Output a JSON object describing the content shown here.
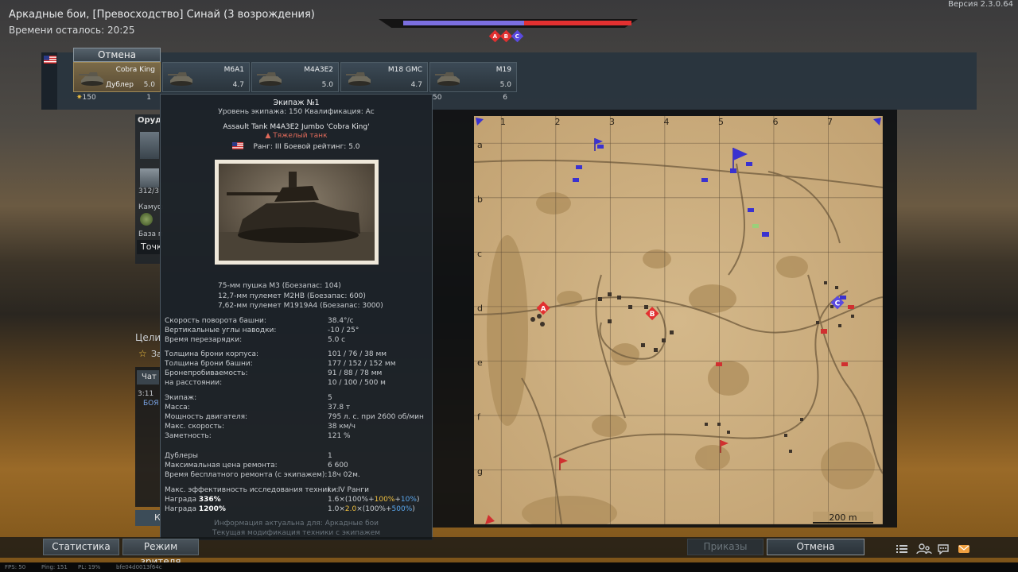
{
  "header": {
    "battle_title": "Аркадные бои, [Превосходство] Синай (3 возрождения)",
    "time_left": "Времени осталось: 20:25",
    "version": "Версия 2.3.0.64"
  },
  "score": {
    "blue_fraction": 0.53,
    "colors": {
      "blue": "#7b6fe0",
      "red": "#e23030"
    }
  },
  "zones": [
    {
      "label": "A",
      "color": "#e23030"
    },
    {
      "label": "B",
      "color": "#e23030"
    },
    {
      "label": "C",
      "color": "#5a4ae0"
    }
  ],
  "vehicles": {
    "cancel_label": "Отмена",
    "slots": [
      {
        "name": "Cobra King",
        "br": "5.0",
        "role": "Дублер",
        "selected": true
      },
      {
        "name": "M6A1",
        "br": "4.7",
        "role": "",
        "selected": false
      },
      {
        "name": "M4A3E2",
        "br": "5.0",
        "role": "",
        "selected": false
      },
      {
        "name": "M18 GMC",
        "br": "4.7",
        "role": "",
        "selected": false
      },
      {
        "name": "M19",
        "br": "5.0",
        "role": "",
        "selected": false
      }
    ],
    "slot_under": [
      {
        "left": "150",
        "right": "1"
      },
      {
        "left": "50",
        "right": "6"
      }
    ]
  },
  "left_fragments": {
    "weapons": "Оруд",
    "ammo": "312/3",
    "camo": "Камуф",
    "base": "База п",
    "point": "Точк",
    "goals": "Цели",
    "goal_item": "За",
    "chat_tab": "Чат",
    "chat_time": "3:11",
    "chat_word": "БОЯ",
    "k_button": "К"
  },
  "tooltip": {
    "crew_title": "Экипаж №1",
    "crew_level": "Уровень экипажа: 150   Квалификация: Ас",
    "vehicle_name": "Assault Tank M4A3E2 Jumbo 'Cobra King'",
    "vehicle_class": "Тяжелый танк",
    "rank_line": "Ранг: III   Боевой рейтинг: 5.0",
    "armament": [
      "75-мм пушка M3 (Боезапас: 104)",
      "12,7-мм пулемет M2HB (Боезапас: 600)",
      "7,62-мм пулемет M1919A4 (Боезапас: 3000)"
    ],
    "stats_group1": [
      {
        "label": "Скорость поворота башни:",
        "value": "38.4°/с"
      },
      {
        "label": "Вертикальные углы наводки:",
        "value": "-10 / 25°"
      },
      {
        "label": "Время перезарядки:",
        "value": "5.0 с"
      }
    ],
    "stats_group2": [
      {
        "label": "Толщина брони корпуса:",
        "value": "101 / 76 / 38 мм"
      },
      {
        "label": "Толщина брони башни:",
        "value": "177 / 152 / 152 мм"
      },
      {
        "label": "Бронепробиваемость:",
        "value": "91 / 88 / 78 мм"
      },
      {
        "label": "на расстоянии:",
        "value": "10 / 100 / 500 м"
      }
    ],
    "stats_group3": [
      {
        "label": "Экипаж:",
        "value": "5"
      },
      {
        "label": "Масса:",
        "value": "37.8 т"
      },
      {
        "label": "Мощность двигателя:",
        "value": "795 л. с. при 2600 об/мин"
      },
      {
        "label": "Макс. скорость:",
        "value": "38 км/ч"
      },
      {
        "label": "Заметность:",
        "value": "121 %"
      }
    ],
    "stats_group4": [
      {
        "label": "Дублеры",
        "value": "1"
      },
      {
        "label": "Максимальная цена ремонта:",
        "value": "6 600"
      },
      {
        "label": "Время бесплатного ремонта (с экипажем):",
        "value": "18ч 02м."
      }
    ],
    "research": {
      "label": "Макс. эффективность исследования техники:",
      "value": "I – IV Ранги"
    },
    "reward1": {
      "label_a": "Награда ",
      "label_b": "336%",
      "value_a": "1.6×(100%+",
      "value_b": "100%",
      "value_c": "+",
      "value_d": "10%",
      "value_e": ")"
    },
    "reward2": {
      "label_a": "Награда ",
      "label_b": "1200%",
      "value_a": "1.0×",
      "value_b": "2.0",
      "value_c": "×(100%+",
      "value_d": "500%",
      "value_e": ")"
    },
    "footer1": "Информация актуальна для: Аркадные бои",
    "footer2": "Текущая модификация техники с экипажем"
  },
  "map": {
    "columns": [
      "1",
      "2",
      "3",
      "4",
      "5",
      "6",
      "7"
    ],
    "rows": [
      "a",
      "b",
      "c",
      "d",
      "e",
      "f",
      "g"
    ],
    "scale_label": "200 m",
    "capture_points": [
      {
        "label": "A",
        "col": 1.3,
        "row": 3.5,
        "color": "#e23030"
      },
      {
        "label": "B",
        "col": 3.3,
        "row": 3.6,
        "color": "#e23030"
      },
      {
        "label": "C",
        "col": 6.7,
        "row": 3.4,
        "color": "#5a4ae0"
      }
    ]
  },
  "bottom": {
    "stats_label": "Статистика",
    "spectator_label": "Режим зрителя",
    "orders_label": "Приказы",
    "cancel_label": "Отмена"
  },
  "footer": {
    "fps": "FPS: 50",
    "ping": "Ping: 151",
    "pl": "PL: 19%",
    "session": "bfe04d0013f64c"
  }
}
